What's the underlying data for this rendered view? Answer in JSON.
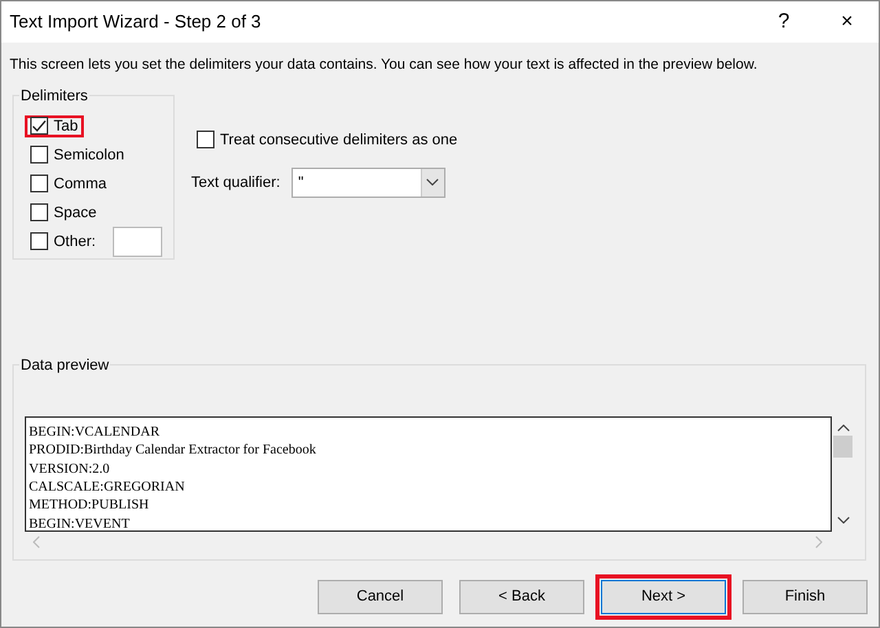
{
  "window": {
    "title": "Text Import Wizard - Step 2 of 3",
    "help": "?",
    "close": "×"
  },
  "description": "This screen lets you set the delimiters your data contains.  You can see how your text is affected in the preview below.",
  "delimiters": {
    "label": "Delimiters",
    "items": [
      {
        "label": "Tab",
        "checked": true,
        "highlighted": true
      },
      {
        "label": "Semicolon",
        "checked": false,
        "highlighted": false
      },
      {
        "label": "Comma",
        "checked": false,
        "highlighted": false
      },
      {
        "label": "Space",
        "checked": false,
        "highlighted": false
      },
      {
        "label": "Other:",
        "checked": false,
        "highlighted": false,
        "has_field": true
      }
    ]
  },
  "consecutive": {
    "label": "Treat consecutive delimiters as one",
    "checked": false
  },
  "qualifier": {
    "label": "Text qualifier:",
    "value": "\""
  },
  "preview": {
    "label": "Data preview",
    "lines": [
      "BEGIN:VCALENDAR",
      "PRODID:Birthday Calendar Extractor for Facebook",
      "VERSION:2.0",
      "CALSCALE:GREGORIAN",
      "METHOD:PUBLISH",
      "BEGIN:VEVENT"
    ]
  },
  "buttons": [
    {
      "label": "Cancel",
      "highlighted": false
    },
    {
      "label": "< Back",
      "highlighted": false
    },
    {
      "label": "Next >",
      "highlighted": true
    },
    {
      "label": "Finish",
      "highlighted": false
    }
  ]
}
